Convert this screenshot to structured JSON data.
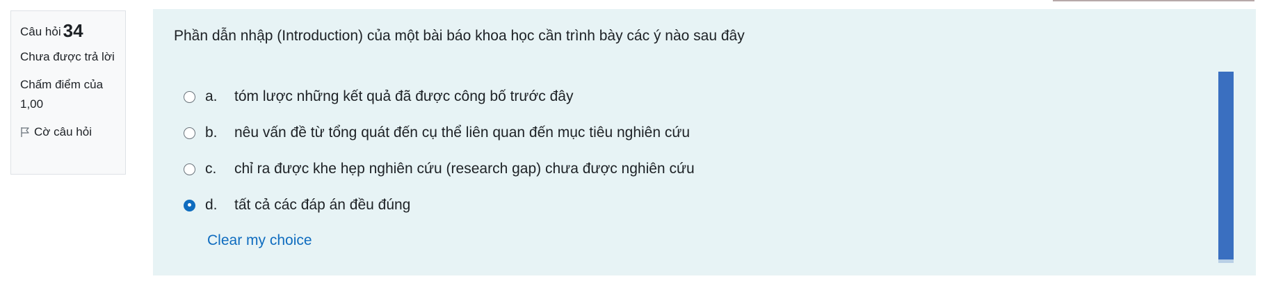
{
  "info": {
    "question_label": "Câu hỏi",
    "question_number": "34",
    "state": "Chưa được trả lời",
    "grade": "Chấm điểm của 1,00",
    "flag_label": "Cờ câu hỏi"
  },
  "question": {
    "text": "Phần dẫn nhập (Introduction) của một bài báo khoa học cần trình bày các ý nào sau đây",
    "options": [
      {
        "letter": "a.",
        "text": "tóm lược những kết quả đã được công bố trước đây",
        "selected": false
      },
      {
        "letter": "b.",
        "text": "nêu vấn đề từ tổng quát đến cụ thể liên quan đến mục tiêu nghiên cứu",
        "selected": false
      },
      {
        "letter": "c.",
        "text": "chỉ ra được khe hẹp nghiên cứu (research gap) chưa được nghiên cứu",
        "selected": false
      },
      {
        "letter": "d.",
        "text": "tất cả các đáp án đều đúng",
        "selected": true
      }
    ],
    "clear_label": "Clear my choice"
  },
  "colors": {
    "panel_bg": "#e7f3f5",
    "accent": "#0f6cbf",
    "scrollbar": "#3a6fc0"
  }
}
